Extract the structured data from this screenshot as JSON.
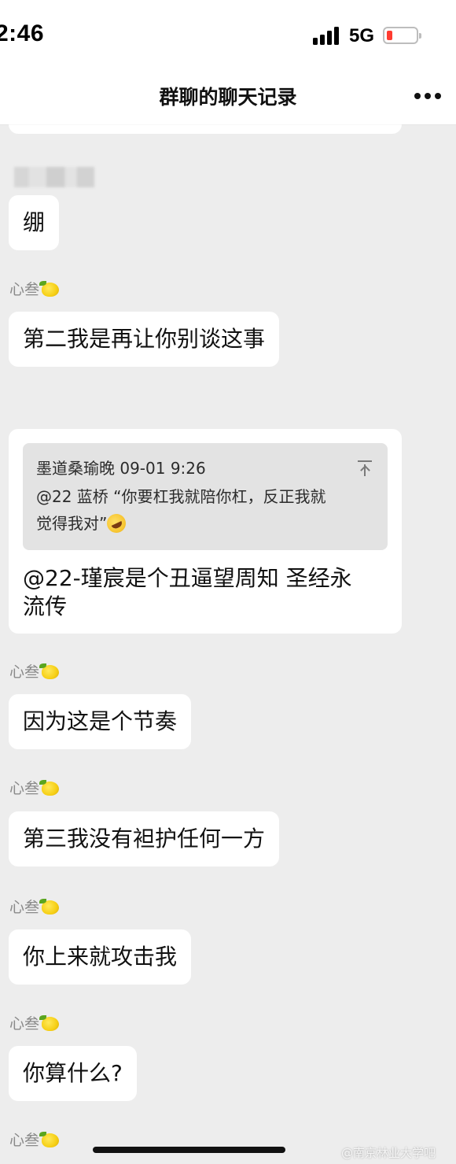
{
  "status_bar": {
    "time": "2:46",
    "network": "5G",
    "battery_color": "#ff3b30"
  },
  "header": {
    "title": "群聊的聊天记录",
    "more_icon": "more-options-icon"
  },
  "messages": [
    {
      "sender": "",
      "text": "绷"
    },
    {
      "sender": "心叁",
      "text": "第二我是再让你别谈这事"
    },
    {
      "sender": "心叁",
      "text": "因为这是个节奏"
    },
    {
      "sender": "心叁",
      "text": "第三我没有袒护任何一方"
    },
    {
      "sender": "心叁",
      "text": "你上来就攻击我"
    },
    {
      "sender": "心叁",
      "text": "你算什么?"
    },
    {
      "sender": "心叁",
      "text": ""
    }
  ],
  "quote": {
    "author": "墨道桑瑜晚",
    "time": "09-01 9:26",
    "line1": "@22 蓝桥 “你要杠我就陪你杠，反正我就",
    "line2": "觉得我对”",
    "reply_line1": "@22-瑾宸是个丑逼望周知 圣经永",
    "reply_line2": "流传"
  },
  "watermark": "@南京林业大学吧",
  "colors": {
    "background": "#ededed",
    "bubble": "#ffffff",
    "quote_box": "#e3e3e3",
    "nickname": "#8a8a8a"
  }
}
